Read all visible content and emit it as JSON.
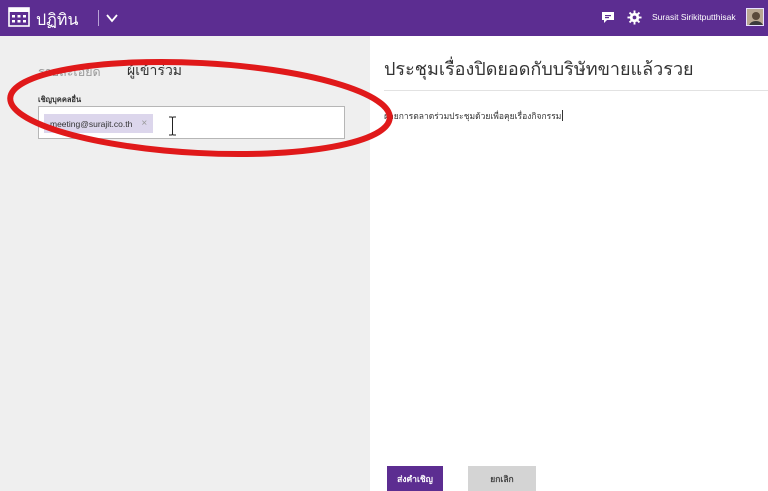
{
  "app": {
    "title": "ปฏิทิน",
    "icons": {
      "launcher": "calendar-grid-icon",
      "dropdown": "chevron-down-icon",
      "chat": "chat-icon",
      "settings": "gear-icon"
    }
  },
  "user": {
    "name": "Surasit Sirikitputthisak"
  },
  "tabs": {
    "details": "รายละเอียด",
    "attendees": "ผู้เข้าร่วม"
  },
  "invite": {
    "label": "เชิญบุคคลอื่น",
    "chips": [
      {
        "email": "meeting@surajit.co.th",
        "remove": "×"
      }
    ]
  },
  "event": {
    "title": "ประชุมเรื่องปิดยอดกับบริษัทขายแล้วรวย",
    "body": "ฝ่ายการตลาดร่วมประชุมด้วยเพื่อคุยเรื่องกิจกรรม"
  },
  "actions": {
    "send": "ส่งคำเชิญ",
    "cancel": "ยกเลิก"
  },
  "colors": {
    "accent": "#5c2d91",
    "annotation": "#e0191a",
    "pane": "#efefef"
  }
}
